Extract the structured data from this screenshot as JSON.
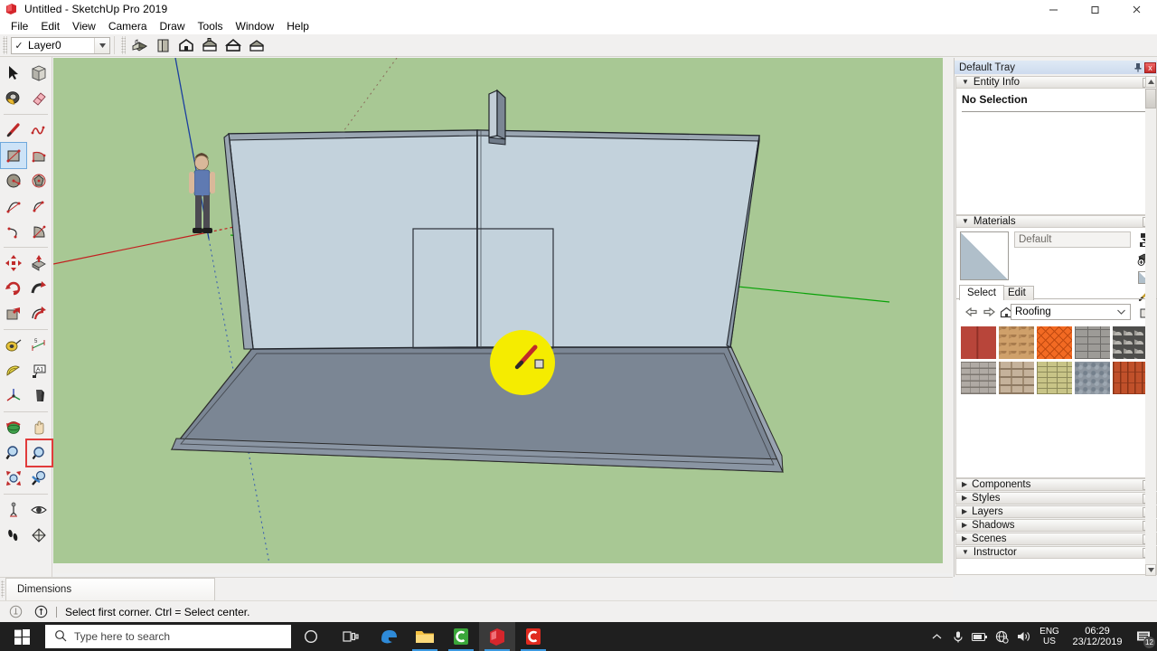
{
  "window": {
    "title": "Untitled - SketchUp Pro 2019",
    "app_icon": "sketchup-icon",
    "minimize_label": "Minimize",
    "maximize_label": "Maximize",
    "close_label": "Close"
  },
  "menubar": {
    "items": [
      {
        "label": "File"
      },
      {
        "label": "Edit"
      },
      {
        "label": "View"
      },
      {
        "label": "Camera"
      },
      {
        "label": "Draw"
      },
      {
        "label": "Tools"
      },
      {
        "label": "Window"
      },
      {
        "label": "Help"
      }
    ]
  },
  "toptoolbar": {
    "layer": {
      "value": "Layer0",
      "checked": true
    },
    "buttons": [
      {
        "name": "iso-view-button",
        "icon": "iso-house-icon"
      },
      {
        "name": "top-view-button",
        "icon": "top-view-icon"
      },
      {
        "name": "front-view-button",
        "icon": "front-house-icon"
      },
      {
        "name": "right-view-button",
        "icon": "right-house-icon"
      },
      {
        "name": "back-view-button",
        "icon": "back-house-icon"
      },
      {
        "name": "left-view-button",
        "icon": "left-house-icon"
      }
    ]
  },
  "lefttoolbar": {
    "groups": [
      {
        "rows": [
          [
            {
              "name": "select-tool",
              "icon": "arrow-cursor-icon",
              "state": "normal"
            },
            {
              "name": "make-component-tool",
              "icon": "component-box-icon",
              "state": "normal"
            }
          ],
          [
            {
              "name": "paint-bucket-tool",
              "icon": "paint-bucket-icon",
              "state": "normal"
            },
            {
              "name": "eraser-tool",
              "icon": "eraser-icon",
              "state": "normal"
            }
          ]
        ]
      },
      {
        "rows": [
          [
            {
              "name": "line-tool",
              "icon": "pencil-icon",
              "state": "normal"
            },
            {
              "name": "freehand-tool",
              "icon": "freehand-squiggle-icon",
              "state": "normal"
            }
          ],
          [
            {
              "name": "rectangle-tool",
              "icon": "rectangle-icon",
              "state": "selected"
            },
            {
              "name": "rotated-rectangle-tool",
              "icon": "rotated-rectangle-icon",
              "state": "normal"
            }
          ],
          [
            {
              "name": "circle-tool",
              "icon": "circle-icon",
              "state": "normal"
            },
            {
              "name": "polygon-tool",
              "icon": "polygon-icon",
              "state": "normal"
            }
          ],
          [
            {
              "name": "arc-tool",
              "icon": "arc-icon",
              "state": "normal"
            },
            {
              "name": "two-point-arc-tool",
              "icon": "two-point-arc-icon",
              "state": "normal"
            }
          ],
          [
            {
              "name": "three-point-arc-tool",
              "icon": "three-point-arc-icon",
              "state": "normal"
            },
            {
              "name": "pie-tool",
              "icon": "pie-icon",
              "state": "normal"
            }
          ]
        ]
      },
      {
        "rows": [
          [
            {
              "name": "move-tool",
              "icon": "move-arrows-icon",
              "state": "normal"
            },
            {
              "name": "push-pull-tool",
              "icon": "push-pull-icon",
              "state": "normal"
            }
          ],
          [
            {
              "name": "rotate-tool",
              "icon": "rotate-icon",
              "state": "normal"
            },
            {
              "name": "follow-me-tool",
              "icon": "follow-me-icon",
              "state": "normal"
            }
          ],
          [
            {
              "name": "scale-tool",
              "icon": "scale-icon",
              "state": "normal"
            },
            {
              "name": "offset-tool",
              "icon": "offset-icon",
              "state": "normal"
            }
          ]
        ]
      },
      {
        "rows": [
          [
            {
              "name": "tape-measure-tool",
              "icon": "tape-measure-icon",
              "state": "normal"
            },
            {
              "name": "dimension-tool",
              "icon": "dimension-icon",
              "state": "normal"
            }
          ],
          [
            {
              "name": "protractor-tool",
              "icon": "protractor-icon",
              "state": "normal"
            },
            {
              "name": "text-tool",
              "icon": "text-label-icon",
              "state": "normal"
            }
          ],
          [
            {
              "name": "axes-tool",
              "icon": "axes-icon",
              "state": "normal"
            },
            {
              "name": "three-d-text-tool",
              "icon": "3d-text-icon",
              "state": "normal"
            }
          ]
        ]
      },
      {
        "rows": [
          [
            {
              "name": "orbit-tool",
              "icon": "orbit-icon",
              "state": "normal"
            },
            {
              "name": "pan-tool",
              "icon": "hand-pan-icon",
              "state": "normal"
            }
          ],
          [
            {
              "name": "zoom-tool",
              "icon": "magnifier-icon",
              "state": "normal"
            },
            {
              "name": "zoom-window-tool",
              "icon": "zoom-window-icon",
              "state": "active"
            }
          ],
          [
            {
              "name": "zoom-extents-tool",
              "icon": "zoom-extents-icon",
              "state": "normal"
            },
            {
              "name": "previous-view-tool",
              "icon": "previous-view-icon",
              "state": "normal"
            }
          ]
        ]
      },
      {
        "rows": [
          [
            {
              "name": "position-camera-tool",
              "icon": "position-camera-icon",
              "state": "normal"
            },
            {
              "name": "look-around-tool",
              "icon": "eye-look-around-icon",
              "state": "normal"
            }
          ],
          [
            {
              "name": "walk-tool",
              "icon": "footsteps-walk-icon",
              "state": "normal"
            },
            {
              "name": "section-plane-tool",
              "icon": "section-plane-icon",
              "state": "normal"
            }
          ]
        ]
      }
    ]
  },
  "viewport": {
    "name": "model-viewport",
    "sky_color": "#a8c894",
    "ground_color": "#a8c894",
    "wall_face_color": "#c3d2dc",
    "wall_side_color": "#8a98a6",
    "floor_color": "#7b8694",
    "blue_axis_color": "#1b3fa0",
    "green_axis_color": "#00a000",
    "red_axis_color": "#c22020",
    "cursor_highlight_color": "#f5ec00",
    "cursor_tool": "pencil-cursor-icon",
    "scale_figure": "person-scale-figure"
  },
  "bottomtabs": {
    "tabs": [
      {
        "label": "Dimensions",
        "selected": true
      }
    ]
  },
  "statusbar": {
    "left_icons": [
      {
        "name": "geolocation-icon"
      },
      {
        "name": "info-circle-icon"
      }
    ],
    "message": "Select first corner. Ctrl = Select center."
  },
  "tray": {
    "title": "Default Tray",
    "pin_icon": "pin-icon",
    "close_label": "x",
    "panels": [
      {
        "name": "entity-info",
        "label": "Entity Info",
        "expanded": true,
        "close_label": "x"
      },
      {
        "name": "materials",
        "label": "Materials",
        "expanded": true,
        "close_label": "x"
      },
      {
        "name": "components",
        "label": "Components",
        "expanded": false,
        "close_label": "x"
      },
      {
        "name": "styles",
        "label": "Styles",
        "expanded": false,
        "close_label": "x"
      },
      {
        "name": "layers",
        "label": "Layers",
        "expanded": false,
        "close_label": "x"
      },
      {
        "name": "shadows",
        "label": "Shadows",
        "expanded": false,
        "close_label": "x"
      },
      {
        "name": "scenes",
        "label": "Scenes",
        "expanded": false,
        "close_label": "x"
      },
      {
        "name": "instructor",
        "label": "Instructor",
        "expanded": true,
        "close_label": "x"
      }
    ],
    "entity_info": {
      "status": "No Selection"
    },
    "materials": {
      "current_name": "Default",
      "buttons": [
        {
          "name": "display-secondary-selection-button",
          "icon": "sample-swap-icon"
        },
        {
          "name": "create-material-button",
          "icon": "create-material-icon"
        },
        {
          "name": "set-default-material-button",
          "icon": "default-material-icon"
        },
        {
          "name": "sample-material-button",
          "icon": "eyedropper-icon"
        },
        {
          "name": "details-button",
          "icon": "details-arrow-icon"
        }
      ],
      "tabs": [
        {
          "label": "Select",
          "selected": true
        },
        {
          "label": "Edit",
          "selected": false
        }
      ],
      "nav": [
        {
          "name": "back-button",
          "icon": "back-arrow-icon"
        },
        {
          "name": "forward-button",
          "icon": "forward-arrow-icon"
        },
        {
          "name": "home-button",
          "icon": "home-icon"
        }
      ],
      "library": "Roofing",
      "swatches": [
        {
          "name": "metal-roof-red",
          "base": "#b8453a",
          "pattern": "vstripe",
          "accent": "#9c3229"
        },
        {
          "name": "shingle-tan-scallop",
          "base": "#d4a濃",
          "pattern": "scallop",
          "accent": "#a87b4d"
        },
        {
          "name": "tile-orange-diamond",
          "base": "#f26a23",
          "pattern": "diamond",
          "accent": "#b84a10"
        },
        {
          "name": "shingle-grey-brick",
          "base": "#9d9b97",
          "pattern": "brick",
          "accent": "#6e6c69"
        },
        {
          "name": "shingle-dark-scallop",
          "base": "#5a5a58",
          "pattern": "scallop2",
          "accent": "#2e2e2d"
        },
        {
          "name": "asphalt-shingle-grey",
          "base": "#b0aaa4",
          "pattern": "hstripe",
          "accent": "#857f79"
        },
        {
          "name": "shingle-beige-mottle",
          "base": "#c5b29b",
          "pattern": "mottle",
          "accent": "#8e7a63"
        },
        {
          "name": "shingle-olive-brick",
          "base": "#c8c487",
          "pattern": "brick",
          "accent": "#8e8b5a"
        },
        {
          "name": "slate-blue-grey",
          "base": "#8d96a0",
          "pattern": "noise",
          "accent": "#6a737d"
        },
        {
          "name": "clay-tile-terracotta",
          "base": "#c0502a",
          "pattern": "vtile",
          "accent": "#8a3417"
        }
      ]
    },
    "scroll": {
      "up_icon": "chevron-up-icon",
      "down_icon": "chevron-down-icon"
    }
  },
  "taskbar": {
    "start_label": "Start",
    "search_placeholder": "Type here to search",
    "search_icon": "search-icon",
    "system_buttons": [
      {
        "name": "cortana-button",
        "icon": "cortana-circle-icon"
      },
      {
        "name": "task-view-button",
        "icon": "task-view-icon"
      }
    ],
    "apps": [
      {
        "name": "edge-taskbar-button",
        "icon": "edge-icon",
        "running": false,
        "active": false
      },
      {
        "name": "file-explorer-taskbar-button",
        "icon": "folder-icon",
        "running": true,
        "active": false
      },
      {
        "name": "app-green-c-taskbar-button",
        "icon": "green-c-icon",
        "running": true,
        "active": false
      },
      {
        "name": "sketchup-taskbar-button",
        "icon": "sketchup-icon",
        "running": true,
        "active": true
      },
      {
        "name": "app-red-c-taskbar-button",
        "icon": "red-c-icon",
        "running": true,
        "active": false
      }
    ],
    "tray": {
      "overflow_icon": "chevron-up-icon",
      "icons": [
        {
          "name": "microphone-icon"
        },
        {
          "name": "battery-icon"
        },
        {
          "name": "network-icon"
        },
        {
          "name": "volume-icon"
        }
      ],
      "language": {
        "line1": "ENG",
        "line2": "US"
      },
      "clock": {
        "time": "06:29",
        "date": "23/12/2019"
      },
      "notifications": {
        "icon": "action-center-icon",
        "count": "12"
      }
    }
  }
}
